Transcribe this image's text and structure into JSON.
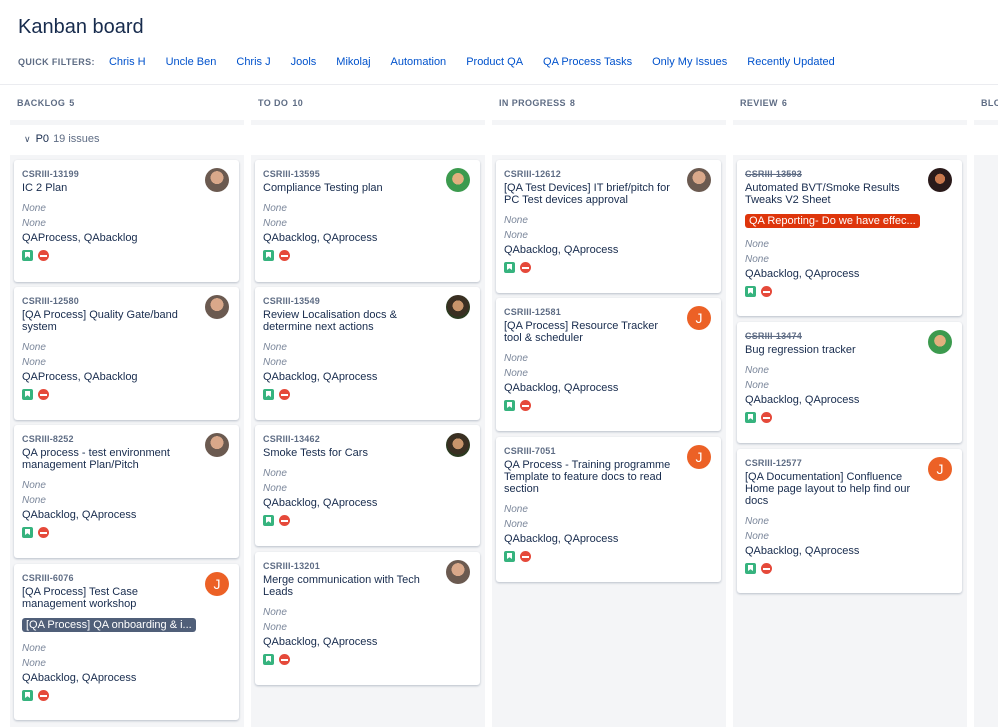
{
  "title": "Kanban board",
  "quick_filters": {
    "label": "QUICK FILTERS:",
    "items": [
      "Chris H",
      "Uncle Ben",
      "Chris J",
      "Jools",
      "Mikolaj",
      "Automation",
      "Product QA",
      "QA Process Tasks",
      "Only My Issues",
      "Recently Updated"
    ]
  },
  "columns": [
    {
      "name": "BACKLOG",
      "count": "5"
    },
    {
      "name": "TO DO",
      "count": "10"
    },
    {
      "name": "IN PROGRESS",
      "count": "8"
    },
    {
      "name": "REVIEW",
      "count": "6"
    },
    {
      "name": "BLO",
      "count": ""
    }
  ],
  "swimlane": {
    "name": "P0",
    "issues": "19 issues"
  },
  "colors": {
    "epic_dark": "#505f79",
    "epic_red": "#de350b",
    "story": "#36b37e",
    "blocker": "#e5493a",
    "avatar_orange": "#ec6126",
    "link": "#0052cc"
  },
  "cards": {
    "backlog": [
      {
        "key": "CSRIII-13199",
        "summary": "IC 2 Plan",
        "f1": "None",
        "f2": "None",
        "labels": "QAProcess, QAbacklog",
        "avatar": "photo"
      },
      {
        "key": "CSRIII-12580",
        "summary": "[QA Process] Quality Gate/band system",
        "f1": "None",
        "f2": "None",
        "labels": "QAProcess, QAbacklog",
        "avatar": "photo"
      },
      {
        "key": "CSRIII-8252",
        "summary": "QA process - test environment management Plan/Pitch",
        "f1": "None",
        "f2": "None",
        "labels": "QAbacklog, QAprocess",
        "avatar": "photo"
      },
      {
        "key": "CSRIII-6076",
        "summary": "[QA Process] Test Case management workshop",
        "epic": "[QA Process] QA onboarding & i...",
        "f1": "None",
        "f2": "None",
        "labels": "QAbacklog, QAprocess",
        "avatar": "J"
      }
    ],
    "todo": [
      {
        "key": "CSRIII-13595",
        "summary": "Compliance Testing plan",
        "f1": "None",
        "f2": "None",
        "labels": "QAbacklog, QAprocess",
        "avatar": "green"
      },
      {
        "key": "CSRIII-13549",
        "summary": "Review Localisation docs & determine next actions",
        "f1": "None",
        "f2": "None",
        "labels": "QAbacklog, QAprocess",
        "avatar": "photo2"
      },
      {
        "key": "CSRIII-13462",
        "summary": "Smoke Tests for Cars",
        "f1": "None",
        "f2": "None",
        "labels": "QAbacklog, QAprocess",
        "avatar": "photo2"
      },
      {
        "key": "CSRIII-13201",
        "summary": "Merge communication with Tech Leads",
        "f1": "None",
        "f2": "None",
        "labels": "QAbacklog, QAprocess",
        "avatar": "photo"
      }
    ],
    "inprogress": [
      {
        "key": "CSRIII-12612",
        "summary": "[QA Test Devices] IT brief/pitch for PC Test devices approval",
        "f1": "None",
        "f2": "None",
        "labels": "QAbacklog, QAprocess",
        "avatar": "photo"
      },
      {
        "key": "CSRIII-12581",
        "summary": "[QA Process] Resource Tracker tool & scheduler",
        "f1": "None",
        "f2": "None",
        "labels": "QAbacklog, QAprocess",
        "avatar": "J"
      },
      {
        "key": "CSRIII-7051",
        "summary": "QA Process - Training programme Template to feature docs to read section",
        "f1": "None",
        "f2": "None",
        "labels": "QAbacklog, QAprocess",
        "avatar": "J"
      }
    ],
    "review": [
      {
        "key": "CSRIII-13593",
        "summary": "Automated BVT/Smoke Results Tweaks V2 Sheet",
        "epic": "QA Reporting- Do we have effec...",
        "f1": "None",
        "f2": "None",
        "labels": "QAbacklog, QAprocess",
        "avatar": "dark"
      },
      {
        "key": "CSRIII-13474",
        "summary": "Bug regression tracker",
        "f1": "None",
        "f2": "None",
        "labels": "QAbacklog, QAprocess",
        "avatar": "green"
      },
      {
        "key": "CSRIII-12577",
        "summary": "[QA Documentation] Confluence Home page layout to help find our docs",
        "f1": "None",
        "f2": "None",
        "labels": "QAbacklog, QAprocess",
        "avatar": "J"
      }
    ]
  }
}
